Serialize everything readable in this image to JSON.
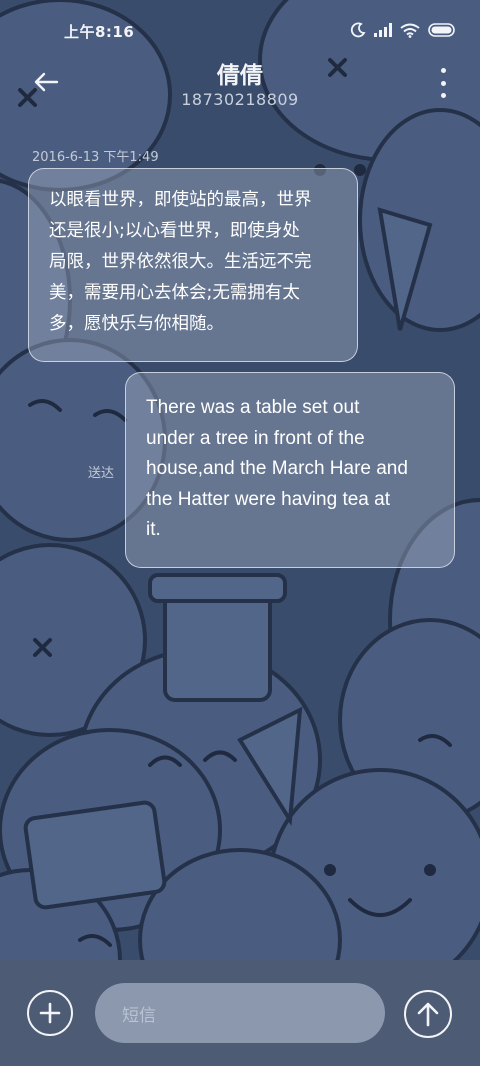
{
  "status_bar": {
    "time": "上午8:16",
    "icons": [
      "moon-icon",
      "signal-icon",
      "wifi-icon",
      "battery-icon"
    ]
  },
  "header": {
    "contact_name": "倩倩",
    "contact_number": "18730218809",
    "back_icon": "back-arrow-icon",
    "more_icon": "more-vertical-icon"
  },
  "conversation": {
    "timestamp": "2016-6-13 下午1:49",
    "messages": [
      {
        "direction": "incoming",
        "lines": [
          "以眼看世界，即使站的最高，世界",
          "还是很小;以心看世界，即使身处",
          "局限，世界依然很大。生活远不完",
          "美，需要用心去体会;无需拥有太",
          "多，愿快乐与你相随。"
        ]
      },
      {
        "direction": "outgoing",
        "status": "送达",
        "lines": [
          "There was a table set out",
          "under a tree in front of the",
          "house,and the March Hare and",
          "the Hatter were having tea at",
          "it."
        ]
      }
    ]
  },
  "composer": {
    "placeholder": "短信",
    "add_icon": "plus-icon",
    "send_icon": "arrow-up-icon"
  },
  "colors": {
    "wallpaper": "#3a4c6c",
    "bubble_fill": "#8d9bb4",
    "composer_bar": "#4d5b74",
    "input_field": "#8b98ae"
  }
}
